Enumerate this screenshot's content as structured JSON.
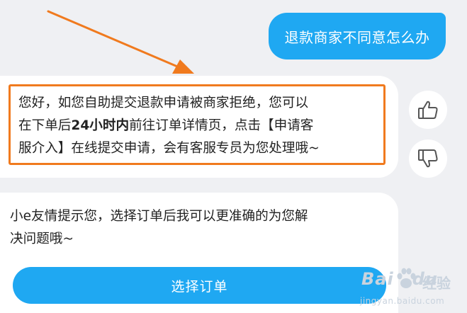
{
  "user_message": "退款商家不同意怎么办",
  "answer": {
    "line1": "您好，如您自助提交退款申请被商家拒绝，您可以",
    "line2_pre": "在下单后",
    "line2_bold": "24小时内",
    "line2_post": "前往订单详情页，点击【申请客",
    "line3": "服介入】在线提交申请，会有客服专员为您处理哦~"
  },
  "reactions": {
    "like_icon": "thumbs-up-icon",
    "dislike_icon": "thumbs-down-icon"
  },
  "tip": {
    "line1": "小e友情提示您，选择订单后我可以更准确的为您解",
    "line2": "决问题哦~",
    "button_label": "选择订单"
  },
  "watermark": {
    "brand": "Bai",
    "brand2": "du",
    "cn": "经验",
    "url": "jingyan.baidu.com"
  },
  "colors": {
    "accent": "#1fa8f2",
    "highlight_border": "#f07a1e",
    "background": "#eff0f3"
  }
}
